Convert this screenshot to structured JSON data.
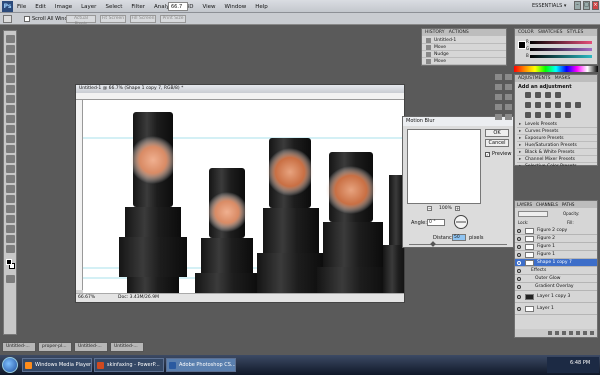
{
  "app": {
    "logo": "Ps",
    "menu": [
      "File",
      "Edit",
      "Image",
      "Layer",
      "Select",
      "Filter",
      "Analysis",
      "3D",
      "View",
      "Window",
      "Help"
    ],
    "zoom": "66.7",
    "workspace": "ESSENTIALS ▾",
    "window_controls": [
      "–",
      "□",
      "×"
    ]
  },
  "options_bar": {
    "scroll_all_label": "Scroll All Windows",
    "buttons": [
      "Actual Pixels",
      "Fit Screen",
      "Fill Screen",
      "Print Size"
    ]
  },
  "document": {
    "title": "Untitled-1 @ 66.7% (Shape 1 copy 7, RGB/8) *",
    "zoom": "66.67%",
    "doc_size": "Doc: 3.43M/26.9M"
  },
  "dialog": {
    "title": "Motion Blur",
    "ok": "OK",
    "cancel": "Cancel",
    "preview_label": "Preview",
    "preview_checked": "✓",
    "zoom_minus": "−",
    "zoom_value": "100%",
    "zoom_plus": "+",
    "angle_label": "Angle:",
    "angle_value": "0",
    "angle_unit": "°",
    "distance_label": "Distance:",
    "distance_value": "50",
    "distance_unit": "pixels"
  },
  "history": {
    "tabs": [
      "HISTORY",
      "ACTIONS"
    ],
    "rows": [
      "Untitled-1",
      "Move",
      "Nudge",
      "Move"
    ]
  },
  "color_panel": {
    "tabs": [
      "COLOR",
      "SWATCHES",
      "STYLES"
    ],
    "channel_labels": [
      "R",
      "G",
      "B"
    ],
    "slider_colors": [
      "#e64f7a",
      "#a26bc6",
      "#2bb9c2"
    ],
    "swatch_strip_colors": [
      "#ff0000",
      "#ff8800",
      "#ffff00",
      "#00ff00",
      "#00ffff",
      "#0000ff",
      "#ff00ff",
      "#ffffff",
      "#000000"
    ]
  },
  "adjustments": {
    "tabs": [
      "ADJUSTMENTS",
      "MASKS"
    ],
    "title": "Add an adjustment",
    "presets": [
      "Levels Presets",
      "Curves Presets",
      "Exposure Presets",
      "Hue/Saturation Presets",
      "Black & White Presets",
      "Channel Mixer Presets",
      "Selective Color Presets"
    ]
  },
  "layers": {
    "tabs": [
      "LAYERS",
      "CHANNELS",
      "PATHS"
    ],
    "blend_mode": "Lock:",
    "opacity_label": "Opacity:",
    "lock_label": "Lock:",
    "fill_label": "Fill:",
    "rows": [
      {
        "name": "Figure 2 copy",
        "selected": false
      },
      {
        "name": "Figure 2",
        "selected": false
      },
      {
        "name": "Figure 1",
        "selected": false
      },
      {
        "name": "Figure 1",
        "selected": false
      },
      {
        "name": "Shape 1 copy 7",
        "selected": true
      },
      {
        "name": "Effects",
        "selected": false
      },
      {
        "name": "Outer Glow",
        "selected": false
      },
      {
        "name": "Gradient Overlay",
        "selected": false
      },
      {
        "name": "Layer 1 copy 3",
        "selected": false
      },
      {
        "name": "Layer 1",
        "selected": false
      }
    ]
  },
  "doc_tabs": [
    "Untitled-...",
    "proper-pl...",
    "Untitled-...",
    "Untitled-..."
  ],
  "taskbar": {
    "tasks": [
      {
        "label": "Windows Media Player",
        "active": false,
        "icon_color": "#ff8c1a"
      },
      {
        "label": "skinfaxing - PowerP...",
        "active": false,
        "icon_color": "#d04a20"
      },
      {
        "label": "Adobe Photoshop CS...",
        "active": true,
        "icon_color": "#2a5aa0"
      }
    ],
    "clock": "6:48 PM"
  }
}
